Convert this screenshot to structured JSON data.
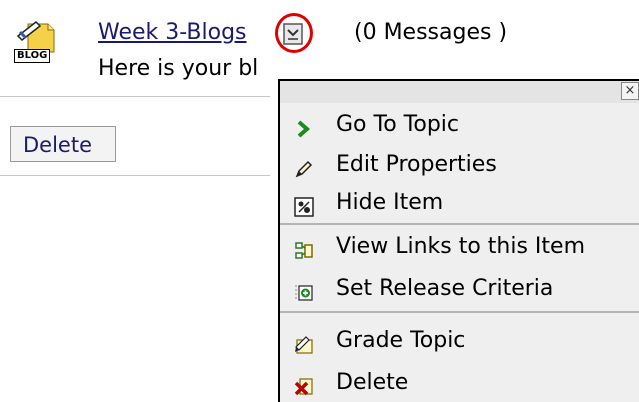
{
  "topic": {
    "title": "Week 3-Blogs",
    "messages": "(0 Messages )",
    "description": "Here is your bl",
    "badge": "BLOG"
  },
  "actions": {
    "delete_label": "Delete"
  },
  "context_menu": {
    "close_glyph": "×",
    "items": [
      {
        "label": "Go To Topic",
        "icon": "chevron-right-icon"
      },
      {
        "label": "Edit Properties",
        "icon": "pencil-icon"
      },
      {
        "label": "Hide Item",
        "icon": "hide-icon"
      },
      {
        "label": "View Links to this Item",
        "icon": "links-icon"
      },
      {
        "label": "Set Release Criteria",
        "icon": "release-criteria-icon"
      },
      {
        "label": "Grade Topic",
        "icon": "grade-icon"
      },
      {
        "label": "Delete",
        "icon": "delete-x-icon"
      }
    ]
  },
  "colors": {
    "link": "#1a1a6e",
    "highlight": "#e00000",
    "menu_bg": "#efefef"
  }
}
